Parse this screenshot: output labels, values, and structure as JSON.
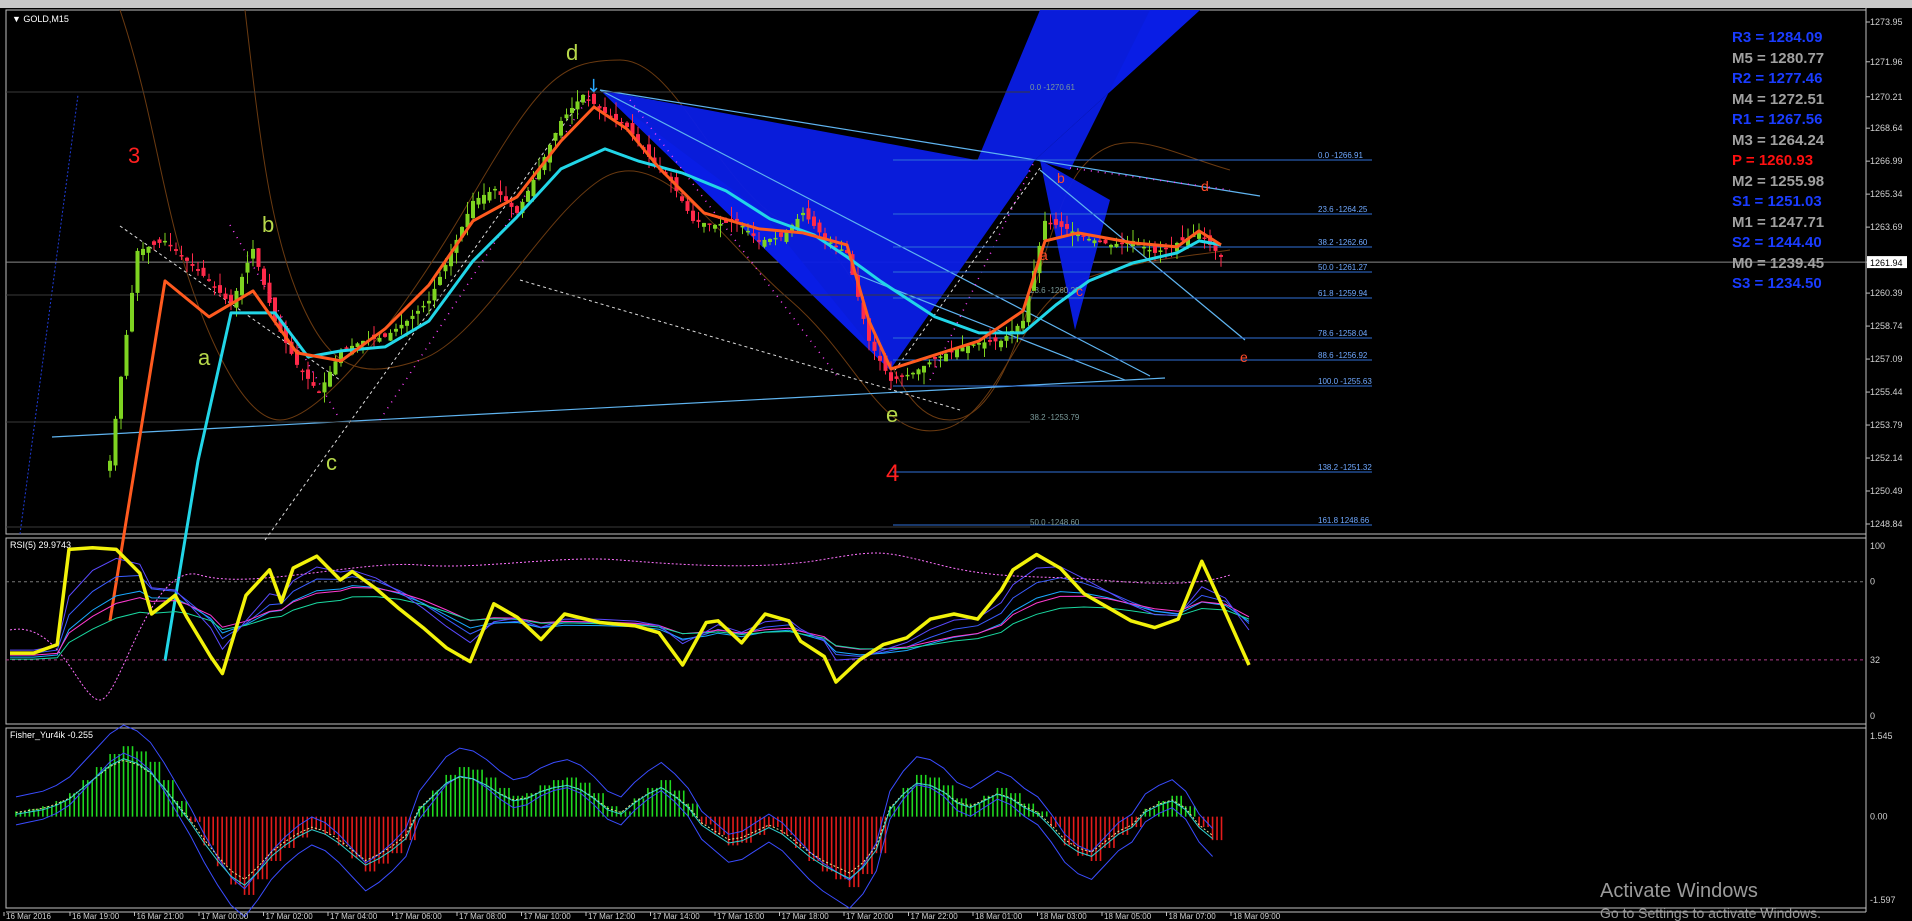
{
  "colors": {
    "background": "#000000",
    "bull": "#7ed321",
    "bear": "#ff2a4a",
    "fast_ma": "#ff5a1f",
    "slow_ma": "#22d6e8",
    "pattern_fill": "#0a1ee6",
    "fib_line": "#2f6fd8",
    "fib_text": "#6fa8ff",
    "rsi_main": "#f2f20a",
    "fisher_pos": "#1fd81f",
    "fisher_neg": "#e41b1b",
    "pivot_r": "#1a3cff",
    "pivot_m": "#a0a0a0",
    "pivot_p": "#ff1010",
    "wave_green": "#b7d84a",
    "wave_red": "#ff2020",
    "axis_text": "#d0d0d0"
  },
  "main": {
    "title": "GOLD,M15",
    "current_price_label": "1261.94",
    "wave_labels": [
      "3",
      "a",
      "b",
      "c",
      "d",
      "e",
      "4"
    ],
    "sub_wave_labels": [
      "a",
      "b",
      "c",
      "d",
      "e"
    ],
    "price_axis_ticks": [
      "1273.95",
      "1271.96",
      "1270.21",
      "1268.64",
      "1266.99",
      "1265.34",
      "1263.69",
      "1261.94",
      "1260.39",
      "1258.74",
      "1257.09",
      "1255.44",
      "1253.79",
      "1252.14",
      "1250.49",
      "1248.84"
    ],
    "fib_right": [
      "0.0 -1266.91",
      "23.6 -1264.25",
      "38.2 -1262.60",
      "50.0 -1261.27",
      "61.8 -1259.94",
      "78.6 -1258.04",
      "88.6 -1256.92",
      "100.0 -1255.63",
      "138.2 -1251.32",
      "161.8 1248.66"
    ],
    "fib_left": [
      "0.0 -1270.61",
      "23.6 -1260.??",
      "38.2 -1253.79",
      "50.0 -1248.60"
    ]
  },
  "pivots": [
    {
      "label": "R3 = 1284.09",
      "color": "#1a3cff"
    },
    {
      "label": "M5 = 1280.77",
      "color": "#a0a0a0"
    },
    {
      "label": "R2 = 1277.46",
      "color": "#1a3cff"
    },
    {
      "label": "M4 = 1272.51",
      "color": "#a0a0a0"
    },
    {
      "label": "R1 = 1267.56",
      "color": "#1a3cff"
    },
    {
      "label": "M3 = 1264.24",
      "color": "#a0a0a0"
    },
    {
      "label": "P  = 1260.93",
      "color": "#ff1010"
    },
    {
      "label": "M2 = 1255.98",
      "color": "#a0a0a0"
    },
    {
      "label": "S1 = 1251.03",
      "color": "#1a3cff"
    },
    {
      "label": "M1 = 1247.71",
      "color": "#a0a0a0"
    },
    {
      "label": "S2 = 1244.40",
      "color": "#1a3cff"
    },
    {
      "label": "M0 = 1239.45",
      "color": "#a0a0a0"
    },
    {
      "label": "S3 = 1234.50",
      "color": "#1a3cff"
    }
  ],
  "rsi": {
    "title": "RSI(5) 29.9743",
    "levels": [
      "100",
      "0",
      "32",
      "0"
    ]
  },
  "fisher": {
    "title": "Fisher_Yur4ik -0.255",
    "levels": [
      "1.545",
      "0.00",
      "-1.597"
    ]
  },
  "time_axis": [
    "16 Mar 2016",
    "16 Mar 19:00",
    "16 Mar 21:00",
    "17 Mar 00:00",
    "17 Mar 02:00",
    "17 Mar 04:00",
    "17 Mar 06:00",
    "17 Mar 08:00",
    "17 Mar 10:00",
    "17 Mar 12:00",
    "17 Mar 14:00",
    "17 Mar 16:00",
    "17 Mar 18:00",
    "17 Mar 20:00",
    "17 Mar 22:00",
    "18 Mar 01:00",
    "18 Mar 03:00",
    "18 Mar 05:00",
    "18 Mar 07:00",
    "18 Mar 09:00"
  ],
  "watermark": {
    "line1": "Activate Windows",
    "line2": "Go to Settings to activate Windows."
  },
  "chart_data": [
    {
      "type": "candlestick",
      "title": "GOLD,M15",
      "ylim": [
        1248.84,
        1273.95
      ],
      "approx_close_path": [
        [
          0,
          1252.0
        ],
        [
          5,
          1262.5
        ],
        [
          10,
          1263.0
        ],
        [
          14,
          1262.0
        ],
        [
          18,
          1261.0
        ],
        [
          22,
          1259.8
        ],
        [
          26,
          1262.6
        ],
        [
          30,
          1259.0
        ],
        [
          34,
          1256.8
        ],
        [
          38,
          1255.4
        ],
        [
          42,
          1257.5
        ],
        [
          46,
          1258.0
        ],
        [
          50,
          1258.2
        ],
        [
          54,
          1259.0
        ],
        [
          58,
          1260.0
        ],
        [
          62,
          1262.4
        ],
        [
          66,
          1265.0
        ],
        [
          70,
          1265.6
        ],
        [
          74,
          1264.4
        ],
        [
          78,
          1266.6
        ],
        [
          82,
          1269.0
        ],
        [
          86,
          1270.3
        ],
        [
          90,
          1269.4
        ],
        [
          94,
          1268.7
        ],
        [
          98,
          1267.2
        ],
        [
          102,
          1266.0
        ],
        [
          106,
          1264.0
        ],
        [
          110,
          1263.8
        ],
        [
          114,
          1264.0
        ],
        [
          118,
          1263.0
        ],
        [
          122,
          1263.2
        ],
        [
          126,
          1264.4
        ],
        [
          130,
          1263.1
        ],
        [
          134,
          1262.4
        ],
        [
          138,
          1258.0
        ],
        [
          142,
          1256.0
        ],
        [
          146,
          1256.4
        ],
        [
          150,
          1257.1
        ],
        [
          154,
          1257.6
        ],
        [
          158,
          1257.9
        ],
        [
          162,
          1258.0
        ],
        [
          166,
          1259.0
        ],
        [
          170,
          1264.0
        ],
        [
          174,
          1263.6
        ],
        [
          178,
          1263.1
        ],
        [
          182,
          1262.8
        ],
        [
          186,
          1263.0
        ],
        [
          190,
          1262.4
        ],
        [
          194,
          1262.9
        ],
        [
          198,
          1263.4
        ],
        [
          202,
          1262.2
        ]
      ],
      "fast_ma": [
        [
          0,
          1244
        ],
        [
          10,
          1261
        ],
        [
          18,
          1259.2
        ],
        [
          26,
          1260.5
        ],
        [
          34,
          1257.4
        ],
        [
          42,
          1257.0
        ],
        [
          50,
          1258.6
        ],
        [
          58,
          1260.8
        ],
        [
          66,
          1264.0
        ],
        [
          74,
          1265.2
        ],
        [
          82,
          1268.0
        ],
        [
          88,
          1269.7
        ],
        [
          94,
          1268.6
        ],
        [
          100,
          1266.6
        ],
        [
          108,
          1264.4
        ],
        [
          118,
          1263.6
        ],
        [
          126,
          1263.4
        ],
        [
          134,
          1262.8
        ],
        [
          138,
          1259.0
        ],
        [
          142,
          1256.6
        ],
        [
          150,
          1257.3
        ],
        [
          158,
          1258.0
        ],
        [
          166,
          1259.5
        ],
        [
          170,
          1263.0
        ],
        [
          176,
          1263.4
        ],
        [
          186,
          1262.9
        ],
        [
          194,
          1262.7
        ],
        [
          198,
          1263.5
        ],
        [
          202,
          1262.8
        ]
      ],
      "slow_ma": [
        [
          10,
          1242
        ],
        [
          16,
          1252
        ],
        [
          22,
          1259.4
        ],
        [
          30,
          1259.4
        ],
        [
          36,
          1257.2
        ],
        [
          42,
          1257.5
        ],
        [
          50,
          1257.7
        ],
        [
          58,
          1259.0
        ],
        [
          66,
          1262.0
        ],
        [
          74,
          1264.2
        ],
        [
          82,
          1266.6
        ],
        [
          90,
          1267.6
        ],
        [
          96,
          1267.0
        ],
        [
          104,
          1266.4
        ],
        [
          112,
          1265.5
        ],
        [
          120,
          1264.1
        ],
        [
          128,
          1263.3
        ],
        [
          134,
          1262.2
        ],
        [
          140,
          1261.0
        ],
        [
          150,
          1259.2
        ],
        [
          158,
          1258.4
        ],
        [
          166,
          1258.4
        ],
        [
          172,
          1259.8
        ],
        [
          178,
          1261.0
        ],
        [
          186,
          1261.9
        ],
        [
          194,
          1262.4
        ],
        [
          198,
          1263.0
        ],
        [
          202,
          1262.8
        ]
      ]
    },
    {
      "type": "line",
      "title": "RSI(5) 29.9743",
      "ylim": [
        0,
        100
      ],
      "series": [
        {
          "values": [
            [
              0,
              37
            ],
            [
              4,
              37
            ],
            [
              8,
              42
            ],
            [
              10,
              98
            ],
            [
              14,
              99
            ],
            [
              18,
              98
            ],
            [
              22,
              84
            ],
            [
              24,
              60
            ],
            [
              28,
              71
            ],
            [
              30,
              58
            ],
            [
              34,
              35
            ],
            [
              36,
              25
            ],
            [
              40,
              71
            ],
            [
              44,
              86
            ],
            [
              46,
              67
            ],
            [
              48,
              87
            ],
            [
              52,
              94
            ],
            [
              56,
              80
            ],
            [
              58,
              85
            ],
            [
              62,
              75
            ],
            [
              66,
              63
            ],
            [
              70,
              52
            ],
            [
              74,
              40
            ],
            [
              78,
              32
            ],
            [
              82,
              66
            ],
            [
              86,
              58
            ],
            [
              90,
              45
            ],
            [
              94,
              60
            ],
            [
              100,
              55
            ],
            [
              106,
              53
            ],
            [
              110,
              49
            ],
            [
              114,
              30
            ],
            [
              118,
              55
            ],
            [
              120,
              56
            ],
            [
              124,
              43
            ],
            [
              128,
              60
            ],
            [
              132,
              56
            ],
            [
              134,
              44
            ],
            [
              138,
              35
            ],
            [
              140,
              20
            ],
            [
              144,
              33
            ],
            [
              148,
              42
            ],
            [
              152,
              46
            ],
            [
              156,
              57
            ],
            [
              160,
              60
            ],
            [
              164,
              57
            ],
            [
              168,
              74
            ],
            [
              170,
              86
            ],
            [
              174,
              95
            ],
            [
              178,
              87
            ],
            [
              182,
              72
            ],
            [
              186,
              64
            ],
            [
              190,
              56
            ],
            [
              194,
              52
            ],
            [
              198,
              57
            ],
            [
              202,
              91
            ],
            [
              206,
              61
            ],
            [
              210,
              30
            ]
          ]
        }
      ]
    },
    {
      "type": "bar",
      "title": "Fisher_Yur4ik -0.255",
      "ylim": [
        -1.597,
        1.545
      ],
      "values": [
        0.1,
        0.15,
        0.2,
        0.3,
        0.45,
        0.7,
        0.95,
        1.2,
        1.35,
        1.25,
        1.05,
        0.7,
        0.3,
        -0.1,
        -0.55,
        -0.95,
        -1.3,
        -1.5,
        -1.2,
        -0.85,
        -0.6,
        -0.4,
        -0.25,
        -0.35,
        -0.55,
        -0.8,
        -1.05,
        -0.9,
        -0.7,
        -0.45,
        0.2,
        0.5,
        0.8,
        0.95,
        0.9,
        0.75,
        0.55,
        0.4,
        0.45,
        0.6,
        0.7,
        0.75,
        0.65,
        0.45,
        0.2,
        0.1,
        0.35,
        0.55,
        0.7,
        0.5,
        0.25,
        -0.15,
        -0.35,
        -0.55,
        -0.5,
        -0.35,
        -0.2,
        -0.35,
        -0.6,
        -0.85,
        -1.05,
        -1.2,
        -1.35,
        -1.1,
        -0.7,
        0.2,
        0.55,
        0.8,
        0.75,
        0.6,
        0.35,
        0.25,
        0.4,
        0.55,
        0.45,
        0.25,
        0.1,
        -0.2,
        -0.55,
        -0.75,
        -0.85,
        -0.6,
        -0.35,
        -0.2,
        0.15,
        0.3,
        0.4,
        0.2,
        -0.2,
        -0.45
      ]
    }
  ]
}
